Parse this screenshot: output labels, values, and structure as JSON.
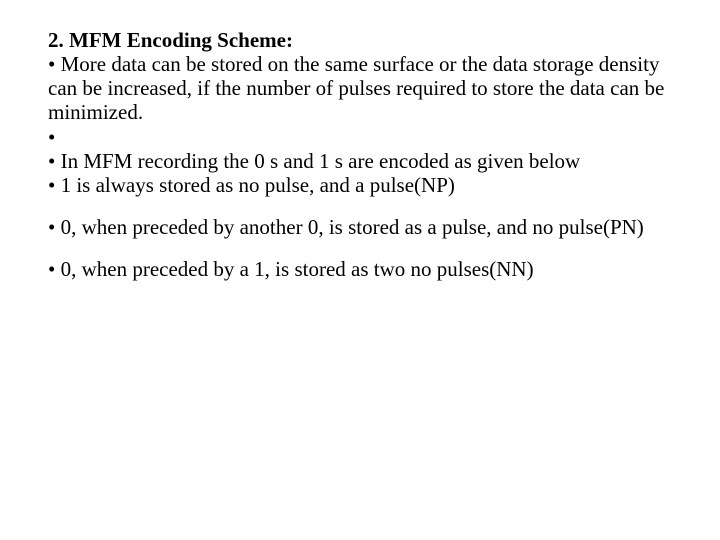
{
  "title_line": "2. MFM Encoding Scheme:",
  "bullets_block1": [
    "• More data can be stored on the same surface or the data storage density can be increased, if the number of pulses required to store the data can be minimized.",
    "•",
    "• In MFM recording the 0 s and 1 s are encoded as given below",
    "• 1 is always stored as no pulse, and a pulse(NP)"
  ],
  "bullets_block2": [
    "• 0, when preceded by another 0, is stored as a pulse, and no pulse(PN)"
  ],
  "bullets_block3": [
    "• 0, when preceded by a 1, is stored as two no pulses(NN)"
  ]
}
